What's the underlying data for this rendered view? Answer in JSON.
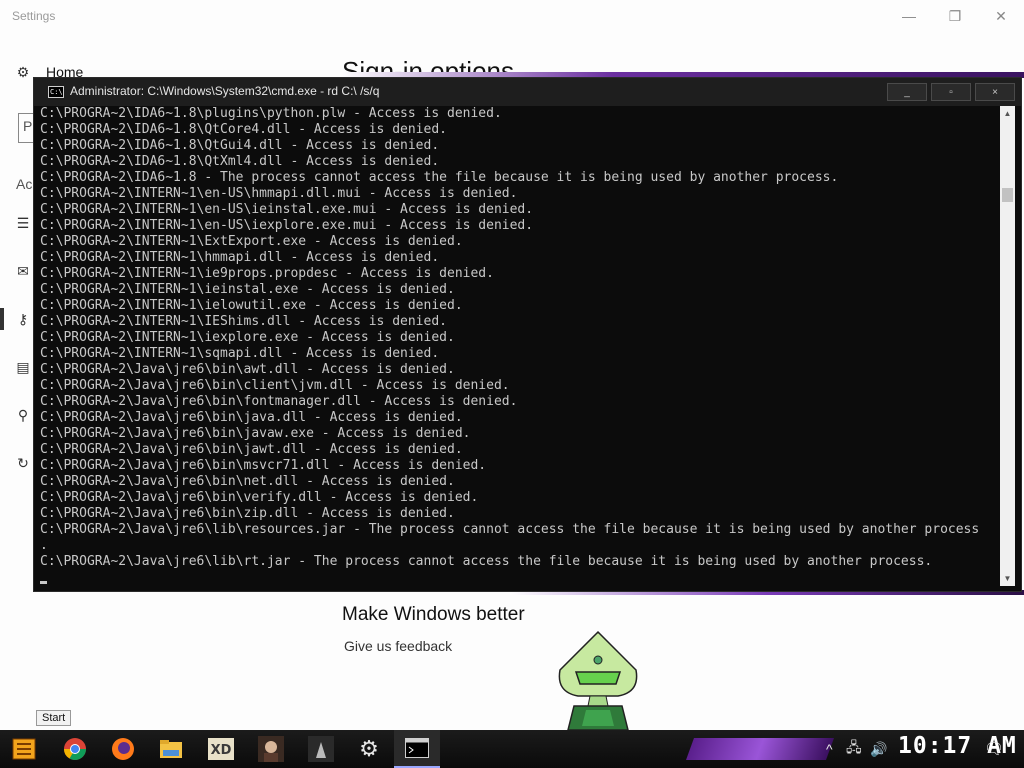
{
  "settings": {
    "title": "Settings",
    "home_label": "Home",
    "page_title": "Sign-in options",
    "sidebar_fragment_1": "P",
    "sidebar_fragment_2": "Ac",
    "make_better": "Make Windows better",
    "feedback": "Give us feedback",
    "minimize": "—",
    "maximize": "❐",
    "close": "✕"
  },
  "cmd": {
    "title": "Administrator: C:\\Windows\\System32\\cmd.exe - rd  C:\\ /s/q",
    "buttons": {
      "minimize": "_",
      "maximize": "▫",
      "close": "×"
    },
    "icon_text": "C:\\",
    "lines": [
      "C:\\PROGRA~2\\IDA6~1.8\\plugins\\python.plw - Access is denied.",
      "C:\\PROGRA~2\\IDA6~1.8\\QtCore4.dll - Access is denied.",
      "C:\\PROGRA~2\\IDA6~1.8\\QtGui4.dll - Access is denied.",
      "C:\\PROGRA~2\\IDA6~1.8\\QtXml4.dll - Access is denied.",
      "C:\\PROGRA~2\\IDA6~1.8 - The process cannot access the file because it is being used by another process.",
      "C:\\PROGRA~2\\INTERN~1\\en-US\\hmmapi.dll.mui - Access is denied.",
      "C:\\PROGRA~2\\INTERN~1\\en-US\\ieinstal.exe.mui - Access is denied.",
      "C:\\PROGRA~2\\INTERN~1\\en-US\\iexplore.exe.mui - Access is denied.",
      "C:\\PROGRA~2\\INTERN~1\\ExtExport.exe - Access is denied.",
      "C:\\PROGRA~2\\INTERN~1\\hmmapi.dll - Access is denied.",
      "C:\\PROGRA~2\\INTERN~1\\ie9props.propdesc - Access is denied.",
      "C:\\PROGRA~2\\INTERN~1\\ieinstal.exe - Access is denied.",
      "C:\\PROGRA~2\\INTERN~1\\ielowutil.exe - Access is denied.",
      "C:\\PROGRA~2\\INTERN~1\\IEShims.dll - Access is denied.",
      "C:\\PROGRA~2\\INTERN~1\\iexplore.exe - Access is denied.",
      "C:\\PROGRA~2\\INTERN~1\\sqmapi.dll - Access is denied.",
      "C:\\PROGRA~2\\Java\\jre6\\bin\\awt.dll - Access is denied.",
      "C:\\PROGRA~2\\Java\\jre6\\bin\\client\\jvm.dll - Access is denied.",
      "C:\\PROGRA~2\\Java\\jre6\\bin\\fontmanager.dll - Access is denied.",
      "C:\\PROGRA~2\\Java\\jre6\\bin\\java.dll - Access is denied.",
      "C:\\PROGRA~2\\Java\\jre6\\bin\\javaw.exe - Access is denied.",
      "C:\\PROGRA~2\\Java\\jre6\\bin\\jawt.dll - Access is denied.",
      "C:\\PROGRA~2\\Java\\jre6\\bin\\msvcr71.dll - Access is denied.",
      "C:\\PROGRA~2\\Java\\jre6\\bin\\net.dll - Access is denied.",
      "C:\\PROGRA~2\\Java\\jre6\\bin\\verify.dll - Access is denied.",
      "C:\\PROGRA~2\\Java\\jre6\\bin\\zip.dll - Access is denied.",
      "C:\\PROGRA~2\\Java\\jre6\\lib\\resources.jar - The process cannot access the file because it is being used by another process",
      ".",
      "C:\\PROGRA~2\\Java\\jre6\\lib\\rt.jar - The process cannot access the file because it is being used by another process."
    ]
  },
  "taskbar": {
    "start_tooltip": "Start",
    "clock": "10:17 AM",
    "items": [
      {
        "name": "start-button",
        "icon": "start-icon"
      },
      {
        "name": "chrome-taskbar-button",
        "icon": "chrome-icon"
      },
      {
        "name": "firefox-taskbar-button",
        "icon": "firefox-icon"
      },
      {
        "name": "file-explorer-taskbar-button",
        "icon": "folder-icon"
      },
      {
        "name": "xd-taskbar-button",
        "icon": "xd-icon"
      },
      {
        "name": "app-taskbar-button-1",
        "icon": "portrait-icon"
      },
      {
        "name": "app-taskbar-button-2",
        "icon": "figure-icon"
      },
      {
        "name": "settings-taskbar-button",
        "icon": "gear-icon"
      },
      {
        "name": "cmd-taskbar-button",
        "icon": "cmd-icon"
      }
    ]
  }
}
